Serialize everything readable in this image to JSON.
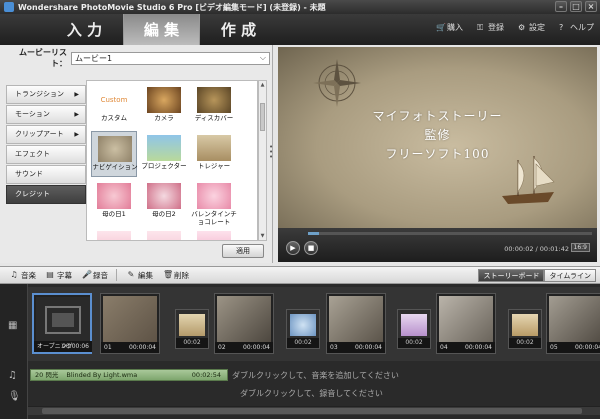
{
  "window": {
    "title": "Wondershare PhotoMovie Studio 6 Pro [ビデオ編集モード] (未登録) - 未題"
  },
  "tabs": [
    {
      "label": "入 力"
    },
    {
      "label": "編 集"
    },
    {
      "label": "作 成"
    }
  ],
  "topmenu": {
    "buy": "購入",
    "register": "登録",
    "settings": "設定",
    "help": "ヘルプ"
  },
  "movie_list": {
    "label": "ムービーリスト：",
    "value": "ムービー1"
  },
  "categories": [
    {
      "label": "トランジション"
    },
    {
      "label": "モーション"
    },
    {
      "label": "クリップアート"
    },
    {
      "label": "エフェクト"
    },
    {
      "label": "サウンド"
    },
    {
      "label": "クレジット"
    }
  ],
  "templates": [
    {
      "caption": "カスタム",
      "thumb_text": "Custom"
    },
    {
      "caption": "カメラ"
    },
    {
      "caption": "ディスカバー"
    },
    {
      "caption": "ナビゲイション"
    },
    {
      "caption": "プロジェクター"
    },
    {
      "caption": "トレジャー"
    },
    {
      "caption": "母の日1"
    },
    {
      "caption": "母の日2"
    },
    {
      "caption": "バレンタインチョコレート"
    }
  ],
  "apply_label": "適用",
  "preview": {
    "lines": [
      "マイフォトストーリー",
      "監修",
      "フリーソフト100"
    ],
    "time": "00:00:02 / 00:01:42",
    "ratio": "16:9",
    "progress": 0.04
  },
  "toolbar": {
    "music": "音楽",
    "subtitle": "字幕",
    "record": "録音",
    "edit": "編集",
    "delete": "削除"
  },
  "modes": {
    "storyboard": "ストーリーボード",
    "timeline": "タイムライン"
  },
  "clips": [
    {
      "name": "オープニング",
      "duration": "00:00:06"
    },
    {
      "name": "01",
      "duration": "00:00:04"
    },
    {
      "name": "02",
      "duration": "00:00:04"
    },
    {
      "name": "03",
      "duration": "00:00:04"
    },
    {
      "name": "04",
      "duration": "00:00:04"
    },
    {
      "name": "05",
      "duration": "00:00:04"
    }
  ],
  "transitions": [
    {
      "duration": "00:02"
    },
    {
      "duration": "00:02"
    },
    {
      "duration": "00:02"
    },
    {
      "duration": "00:02"
    }
  ],
  "music_track": {
    "name": "20 閃光",
    "song": "Blinded By Light.wma",
    "duration": "00:02:54"
  },
  "hints": {
    "music": "ダブルクリックして、音楽を追加してください",
    "record": "ダブルクリックして、録音してください"
  }
}
